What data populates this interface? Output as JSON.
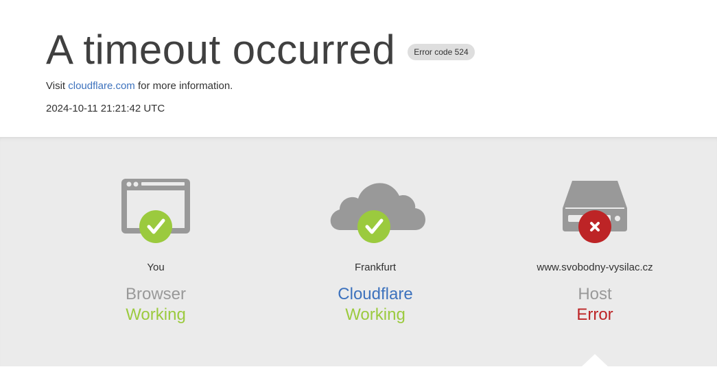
{
  "header": {
    "title": "A timeout occurred",
    "error_badge": "Error code 524",
    "visit_prefix": "Visit",
    "visit_link": "cloudflare.com",
    "visit_suffix": "for more information.",
    "timestamp": "2024-10-11 21:21:42 UTC"
  },
  "colors": {
    "working": "#9bca3e",
    "error": "#bd2426",
    "link": "#3d72bd",
    "icon_gray": "#999999"
  },
  "nodes": [
    {
      "icon": "browser-icon",
      "location": "You",
      "name": "Browser",
      "status": "Working",
      "state": "ok"
    },
    {
      "icon": "cloud-icon",
      "location": "Frankfurt",
      "name": "Cloudflare",
      "status": "Working",
      "state": "ok"
    },
    {
      "icon": "server-icon",
      "location": "www.svobodny-vysilac.cz",
      "name": "Host",
      "status": "Error",
      "state": "error"
    }
  ]
}
